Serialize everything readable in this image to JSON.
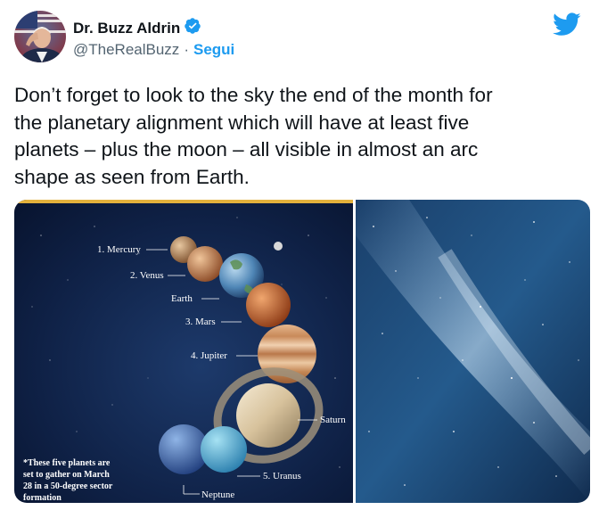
{
  "author": {
    "name": "Dr. Buzz Aldrin",
    "handle": "@TheRealBuzz",
    "separator": "·",
    "follow_label": "Segui"
  },
  "tweet": {
    "text_lines": [
      "Don’t forget to look to the sky the end of the month for",
      "the planetary alignment which will have at least five",
      "planets – plus the moon – all visible in almost an arc",
      "shape as seen from Earth."
    ]
  },
  "infographic": {
    "labels": {
      "mercury": "1. Mercury",
      "venus": "2. Venus",
      "earth": "Earth",
      "mars": "3. Mars",
      "jupiter": "4. Jupiter",
      "saturn": "Saturn",
      "uranus": "5. Uranus",
      "neptune": "Neptune"
    },
    "note_lines": [
      "*These five planets are",
      "set to gather on March",
      "28 in a 50-degree sector",
      "formation"
    ]
  },
  "colors": {
    "accent": "#1d9bf0",
    "verified": "#1d9bf0",
    "infographic_top_bar": "#e3b13c"
  },
  "icons": {
    "verified": "verified-badge-icon",
    "brand": "twitter-bird-icon"
  }
}
